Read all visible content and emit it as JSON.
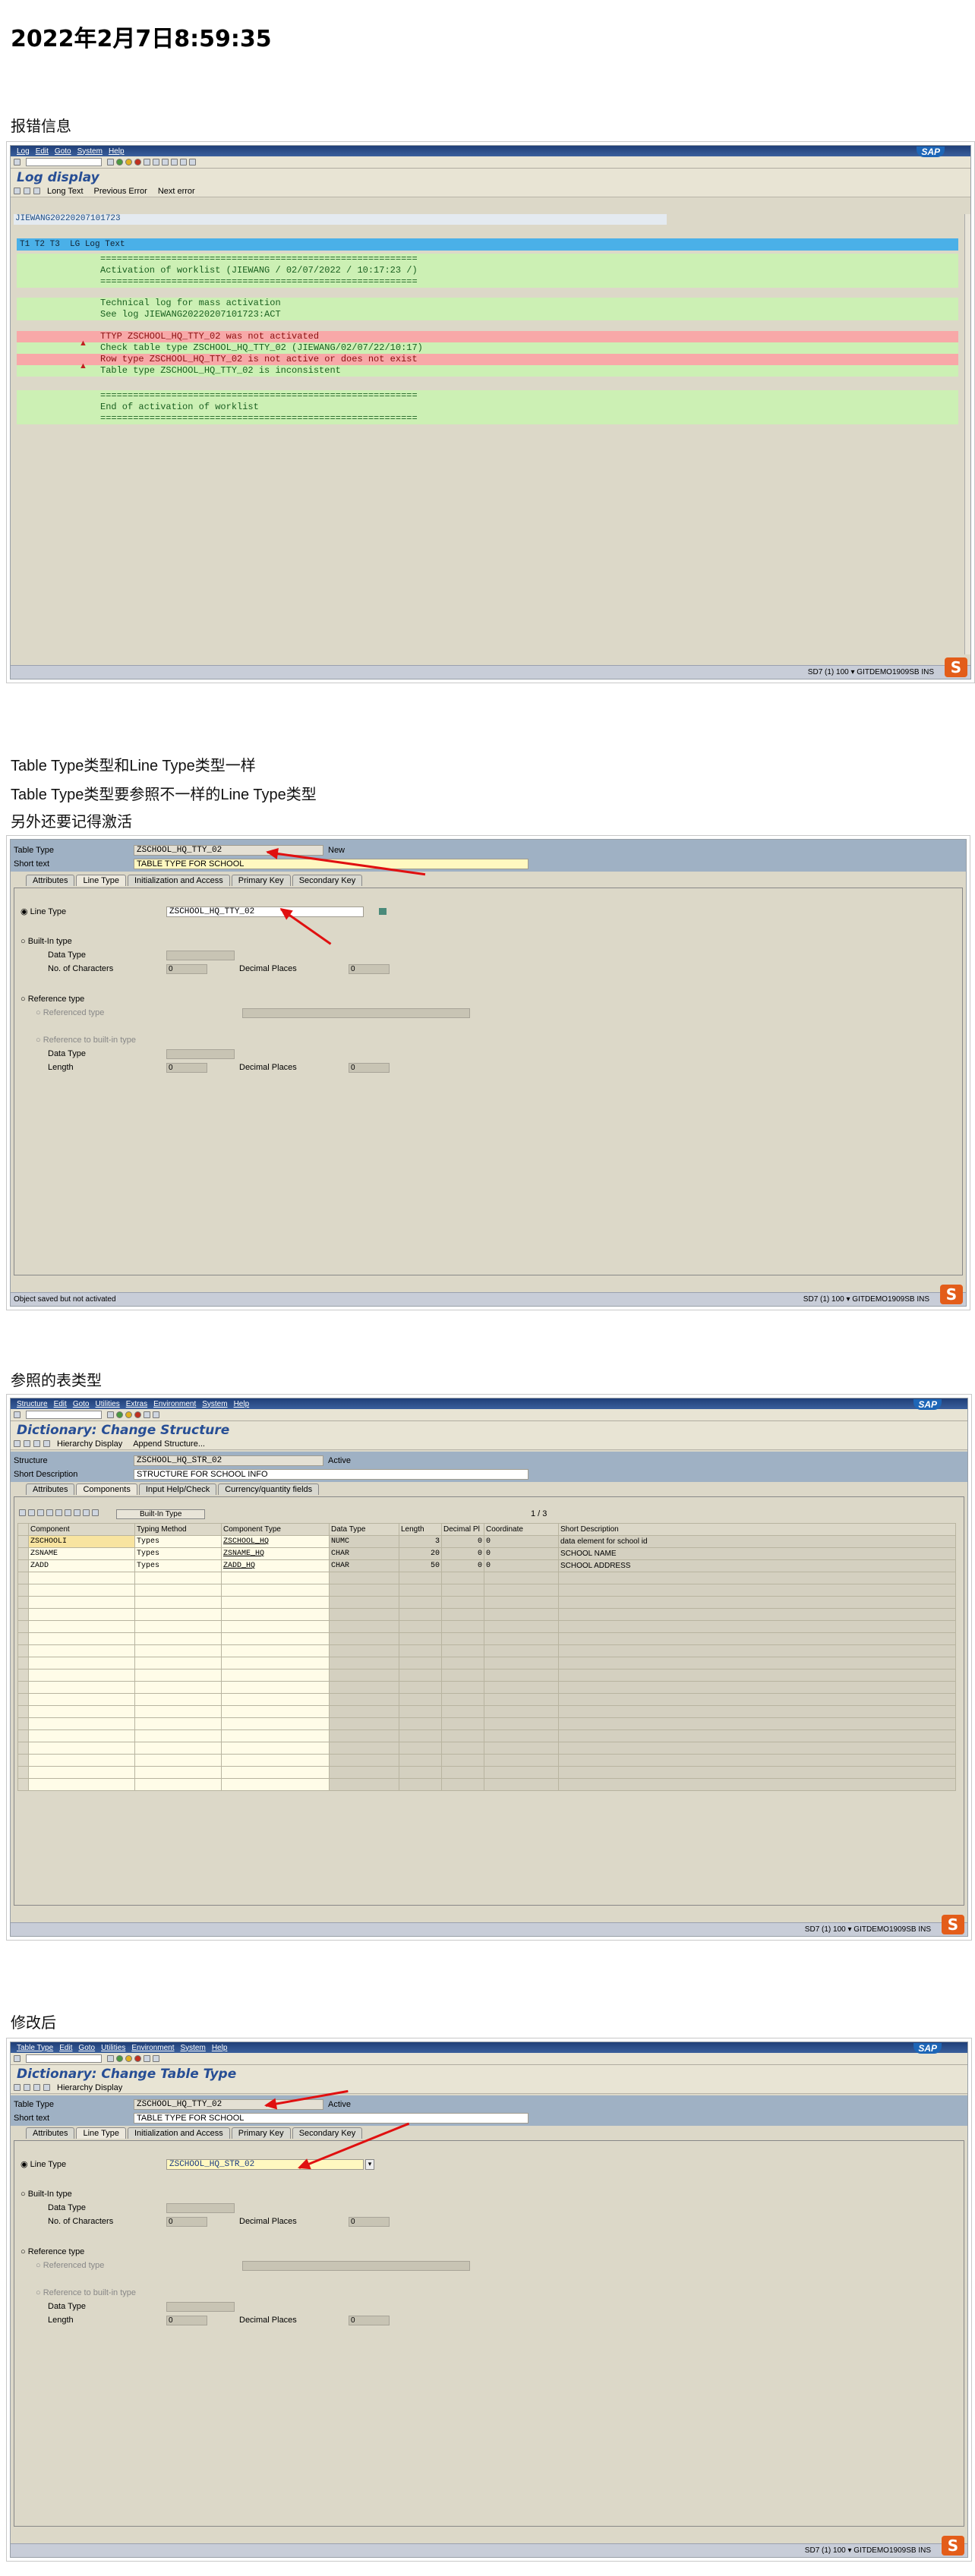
{
  "title": "2022年2月7日8:59:35",
  "caption1": "报错信息",
  "note1": "Table Type类型和Line Type类型一样",
  "note2": "Table Type类型要参照不一样的Line Type类型",
  "note3": "另外还要记得激活",
  "caption3": "参照的表类型",
  "caption4": "修改后",
  "sap_logo": "SAP",
  "s_logo": "S",
  "menu1": [
    "Log",
    "Edit",
    "Goto",
    "System",
    "Help"
  ],
  "menu2": [
    "Table Type",
    "Edit",
    "Goto",
    "Utilities",
    "Environment",
    "System",
    "Help"
  ],
  "menu3": [
    "Structure",
    "Edit",
    "Goto",
    "Utilities",
    "Extras",
    "Environment",
    "System",
    "Help"
  ],
  "shot1": {
    "title": "Log display",
    "buttons": {
      "long_text": "Long Text",
      "prev": "Previous Error",
      "next": "Next error"
    },
    "log_id": "JIEWANG20220207101723",
    "header": "T1 T2 T3  LG Log Text",
    "sep": "==========================================================",
    "line_act": "Activation of worklist (JIEWANG / 02/07/2022 / 10:17:23 /)",
    "line_tech": "Technical log for mass activation",
    "line_see": "See log JIEWANG20220207101723:ACT",
    "line_e1": "TTYP ZSCHOOL_HQ_TTY_02 was not activated",
    "line_chk": "Check table type ZSCHOOL_HQ_TTY_02 (JIEWANG/02/07/22/10:17)",
    "line_e2": "Row type ZSCHOOL_HQ_TTY_02 is not active or does not exist",
    "line_inc": "Table type ZSCHOOL_HQ_TTY_02 is inconsistent",
    "line_end": "End of activation of worklist",
    "status": "SD7 (1) 100 ▾ GITDEMO1909SB  INS"
  },
  "shot2": {
    "table_type_label": "Table Type",
    "table_type": "ZSCHOOL_HQ_TTY_02",
    "table_type_state": "New",
    "short_text_label": "Short text",
    "short_text": "TABLE TYPE FOR SCHOOL",
    "tabs": [
      "Attributes",
      "Line Type",
      "Initialization and Access",
      "Primary Key",
      "Secondary Key"
    ],
    "line_type_label": "Line Type",
    "line_type": "ZSCHOOL_HQ_TTY_02",
    "builtin": "Built-In type",
    "data_type": "Data Type",
    "no_chars": "No. of Characters",
    "zero": "0",
    "decimal": "Decimal Places",
    "ref_type": "Reference type",
    "ref_type_sub": "Referenced type",
    "ref_builtin": "Reference to built-in type",
    "length": "Length",
    "status_msg": "Object saved but not activated",
    "status": "SD7 (1) 100 ▾ GITDEMO1909SB  INS"
  },
  "shot3": {
    "title": "Dictionary: Change Structure",
    "toolbar": [
      "Hierarchy Display",
      "Append Structure..."
    ],
    "structure_label": "Structure",
    "structure": "ZSCHOOL_HQ_STR_02",
    "state": "Active",
    "short_desc_label": "Short Description",
    "short_desc": "STRUCTURE FOR SCHOOL INFO",
    "tabs": [
      "Attributes",
      "Components",
      "Input Help/Check",
      "Currency/quantity fields"
    ],
    "builtin_btn": "Built-In Type",
    "pager": "1  /  3",
    "cols": [
      "Component",
      "Typing Method",
      "Component Type",
      "Data Type",
      "Length",
      "Decimal Pl",
      "Coordinate",
      "Short Description"
    ],
    "rows": [
      [
        "ZSCHOOLI",
        "Types",
        "ZSCHOOL_HQ",
        "NUMC",
        "3",
        "0",
        "0",
        "data element for school id"
      ],
      [
        "ZSNAME",
        "Types",
        "ZSNAME_HQ",
        "CHAR",
        "20",
        "0",
        "0",
        "SCHOOL NAME"
      ],
      [
        "ZADD",
        "Types",
        "ZADD_HQ",
        "CHAR",
        "50",
        "0",
        "0",
        "SCHOOL ADDRESS"
      ]
    ],
    "num_one": "1",
    "status": "SD7 (1) 100 ▾ GITDEMO1909SB  INS"
  },
  "shot4": {
    "title": "Dictionary: Change Table Type",
    "toolbar": [
      "Hierarchy Display"
    ],
    "table_type": "ZSCHOOL_HQ_TTY_02",
    "state": "Active",
    "short_text": "TABLE TYPE FOR SCHOOL",
    "line_type": "ZSCHOOL_HQ_STR_02",
    "status": "SD7 (1) 100 ▾ GITDEMO1909SB  INS"
  }
}
